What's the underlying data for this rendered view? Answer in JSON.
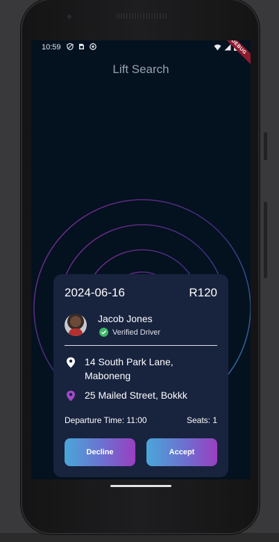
{
  "status": {
    "time": "10:59",
    "debug_label": "DEBUG"
  },
  "title": "Lift Search",
  "card": {
    "date": "2024-06-16",
    "price": "R120",
    "driver": {
      "name": "Jacob Jones",
      "status": "Verified Driver"
    },
    "pickup": "14 South Park Lane, Maboneng",
    "dropoff": "25 Mailed Street, Bokkk",
    "departure": "Departure Time: 11:00",
    "seats": "Seats: 1",
    "decline_label": "Decline",
    "accept_label": "Accept"
  },
  "colors": {
    "background": "#04111f",
    "card": "#18233e",
    "verified": "#3fb768",
    "dropoff_pin": "#a04ac8",
    "button_gradient_start": "#4aa7d8",
    "button_gradient_end": "#9a3fc0"
  },
  "icons": {
    "status": [
      "shield-icon",
      "sim-card-icon",
      "notification-icon",
      "wifi-icon",
      "signal-icon",
      "battery-icon"
    ],
    "verified": "check-circle-icon",
    "pickup": "location-pin-icon",
    "dropoff": "location-pin-icon"
  }
}
